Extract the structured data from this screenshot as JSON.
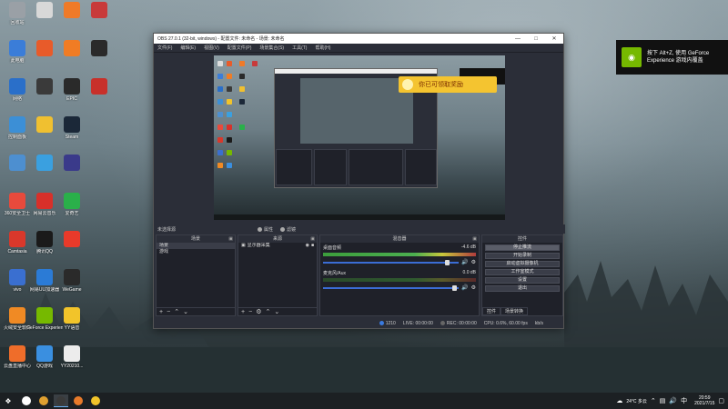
{
  "desktop": {
    "icons": [
      {
        "label": "回收站",
        "color": "#9aa0a6",
        "col": 0,
        "row": 0
      },
      {
        "label": "此电脑",
        "color": "#3b7dd8",
        "col": 0,
        "row": 1
      },
      {
        "label": "网络",
        "color": "#2a6fc9",
        "col": 0,
        "row": 2
      },
      {
        "label": "控制面板",
        "color": "#3c8fd6",
        "col": 0,
        "row": 3
      },
      {
        "label": "",
        "color": "#4d8fd0",
        "col": 0,
        "row": 4
      },
      {
        "label": "360安全卫士",
        "color": "#e84a3c",
        "col": 0,
        "row": 5
      },
      {
        "label": "Camtasia",
        "color": "#d9382b",
        "col": 0,
        "row": 6
      },
      {
        "label": "vivo",
        "color": "#3a6fd0",
        "col": 0,
        "row": 7
      },
      {
        "label": "火绒安全软件",
        "color": "#f08a24",
        "col": 0,
        "row": 8
      },
      {
        "label": "云盘直播中心",
        "color": "#ef6d2a",
        "col": 0,
        "row": 9
      },
      {
        "label": "",
        "color": "#d8d8d8",
        "col": 1,
        "row": 0
      },
      {
        "label": "",
        "color": "#e85b2a",
        "col": 1,
        "row": 1
      },
      {
        "label": "",
        "color": "#3a3a3a",
        "col": 1,
        "row": 2
      },
      {
        "label": "",
        "color": "#f0c030",
        "col": 1,
        "row": 3
      },
      {
        "label": "",
        "color": "#3aa0e0",
        "col": 1,
        "row": 4
      },
      {
        "label": "网易云音乐",
        "color": "#d8302a",
        "col": 1,
        "row": 5
      },
      {
        "label": "腾讯QQ",
        "color": "#1a1a1a",
        "col": 1,
        "row": 6
      },
      {
        "label": "网易UU加速器",
        "color": "#2b7bd6",
        "col": 1,
        "row": 7
      },
      {
        "label": "GeForce Experience",
        "color": "#76b900",
        "col": 1,
        "row": 8
      },
      {
        "label": "QQ游戏",
        "color": "#3a8fe0",
        "col": 1,
        "row": 9
      },
      {
        "label": "",
        "color": "#ef7a28",
        "col": 2,
        "row": 0
      },
      {
        "label": "",
        "color": "#f07c24",
        "col": 2,
        "row": 1
      },
      {
        "label": "EPIC",
        "color": "#2a2a2a",
        "col": 2,
        "row": 2
      },
      {
        "label": "Steam",
        "color": "#1b2838",
        "col": 2,
        "row": 3
      },
      {
        "label": "",
        "color": "#3a3a8a",
        "col": 2,
        "row": 4
      },
      {
        "label": "爱奇艺",
        "color": "#2ab04a",
        "col": 2,
        "row": 5
      },
      {
        "label": "",
        "color": "#e83a2a",
        "col": 2,
        "row": 6
      },
      {
        "label": "WeGame",
        "color": "#2a2a2a",
        "col": 2,
        "row": 7
      },
      {
        "label": "YY语音",
        "color": "#f2c42a",
        "col": 2,
        "row": 8
      },
      {
        "label": "YY20210...",
        "color": "#ececec",
        "col": 2,
        "row": 9
      },
      {
        "label": "",
        "color": "#c83a3a",
        "col": 3,
        "row": 0
      },
      {
        "label": "",
        "color": "#2a2a2a",
        "col": 3,
        "row": 1
      },
      {
        "label": "",
        "color": "#c8302a",
        "col": 3,
        "row": 2
      }
    ]
  },
  "obs": {
    "title": "OBS 27.0.1 (32-bit, windows) - 配置文件: 未命名 - 场景: 未命名",
    "menu": [
      "文件(F)",
      "编辑(E)",
      "视图(V)",
      "配置文件(P)",
      "场景集合(S)",
      "工具(T)",
      "帮助(H)"
    ],
    "preview_toast": "你已可领取奖励",
    "no_source": "未选择源",
    "props_label": "属性",
    "filters_label": "滤镜",
    "scenes": {
      "header": "场景",
      "items": [
        "场景",
        "游戏"
      ]
    },
    "sources": {
      "header": "来源",
      "items": [
        "显示器采集"
      ]
    },
    "mixer": {
      "header": "混音器",
      "channels": [
        {
          "name": "桌面音频",
          "db": "-4.6 dB",
          "level": 0.9
        },
        {
          "name": "麦克风/Aux",
          "db": "0.0 dB",
          "level": 0.0
        }
      ]
    },
    "controls": {
      "header": "控件",
      "buttons": [
        "停止推流",
        "开始录制",
        "启动虚拟摄像机",
        "工作室模式",
        "设置",
        "退出"
      ],
      "tabs": [
        "控件",
        "场景转换"
      ]
    },
    "status": {
      "drop": "",
      "live_time": "LIVE: 00:00:00",
      "rec_time": "REC: 00:00:00",
      "cpu": "CPU: 0.6%, 60.00 fps",
      "kbps": "kb/s",
      "bitrate": "1210"
    }
  },
  "nvidia": {
    "line1": "按下 Alt+Z, 使用 GeForce",
    "line2": "Experience 游戏内覆盖"
  },
  "taskbar": {
    "start_icon": "windows-icon",
    "apps": [
      {
        "name": "search",
        "color": "#ffffff"
      },
      {
        "name": "chrome",
        "color": "#e0a030"
      },
      {
        "name": "obs",
        "color": "#3a3a3a"
      },
      {
        "name": "tencent",
        "color": "#e87a2a"
      },
      {
        "name": "yy",
        "color": "#f2c42a"
      }
    ],
    "weather": "24°C 多云",
    "time": "20:59",
    "date": "2021/7/15"
  }
}
